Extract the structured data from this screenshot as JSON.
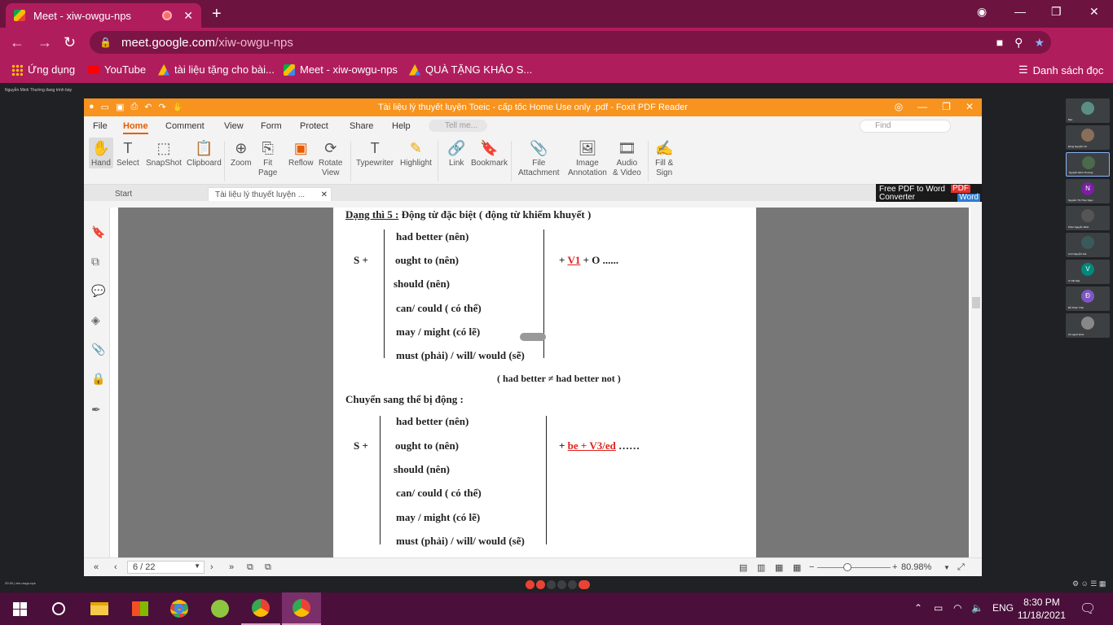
{
  "browser": {
    "tab_title": "Meet - xiw-owgu-nps",
    "url_domain": "meet.google.com",
    "url_path": "/xiw-owgu-nps",
    "bookmarks": [
      "Ứng dụng",
      "YouTube",
      "tài liệu tặng cho bài...",
      "Meet - xiw-owgu-nps",
      "QUÀ TẶNG KHẢO S..."
    ],
    "reading_list": "Danh sách đọc"
  },
  "foxit": {
    "title": "Tài liệu lý thuyết luyện Toeic - cấp tốc Home Use only .pdf - Foxit PDF Reader",
    "menu": [
      "File",
      "Home",
      "Comment",
      "View",
      "Form",
      "Protect",
      "Share",
      "Help"
    ],
    "tell_me": "Tell me...",
    "find": "Find",
    "tools": {
      "hand": "Hand",
      "select": "Select",
      "snapshot": "SnapShot",
      "clipboard": "Clipboard",
      "zoom": "Zoom",
      "fit1": "Fit",
      "fit2": "Page",
      "reflow": "Reflow",
      "rotate1": "Rotate",
      "rotate2": "View",
      "typewriter": "Typewriter",
      "highlight": "Highlight",
      "link": "Link",
      "bookmark": "Bookmark",
      "file1": "File",
      "file2": "Attachment",
      "image1": "Image",
      "image2": "Annotation",
      "audio1": "Audio",
      "audio2": "& Video",
      "fill1": "Fill &",
      "fill2": "Sign"
    },
    "doc_tabs": [
      "Start",
      "Tài liệu lý thuyết luyện ..."
    ],
    "promo": {
      "line1": "Free PDF to Word",
      "line2": "Converter",
      "pdf": "PDF",
      "word": "Word"
    },
    "status": {
      "page": "6 / 22",
      "zoom": "80.98%"
    }
  },
  "document": {
    "heading_label": "Dạng thì 5 :",
    "heading_text": " Động từ đặc biệt ( động từ khiếm khuyết )",
    "subject": "S +",
    "modals": [
      "had better (nên)",
      "ought to (nên)",
      "should (nên)",
      "can/ could ( có thể)",
      "may / might (có lẽ)",
      "must (phải) / will/ would (sẽ)"
    ],
    "active_prefix": "+ ",
    "active_red": "V1",
    "active_suffix": " + O ......",
    "note": "( had better ≠ had better not )",
    "passive_heading": "Chuyển sang thể bị động :",
    "passive_prefix": "+ ",
    "passive_red": "be + V3/ed",
    "passive_suffix": " ……"
  },
  "meet": {
    "presenter_label": "Nguyễn Minh Thường đang trình bày",
    "meeting_code": "20:30  |  xiw-owgu-nps",
    "participants": [
      {
        "name": "Bạn",
        "initial": "",
        "color": "#5a8f86"
      },
      {
        "name": "Đông Nguyễn Vũ",
        "initial": "",
        "color": "#8a6e5a"
      },
      {
        "name": "Nguyễn Minh Thường",
        "initial": "",
        "color": "#4a6a4a"
      },
      {
        "name": "Nguyễn Thị Thúy Ngọc",
        "initial": "N",
        "color": "#7b1fa2"
      },
      {
        "name": "Phúc Nguyễn Minh",
        "initial": "",
        "color": "#555"
      },
      {
        "name": "Linh Nguyễn Gia",
        "initial": "",
        "color": "#3a5a5a"
      },
      {
        "name": "Vi Văn Đại",
        "initial": "V",
        "color": "#00897b"
      },
      {
        "name": "Đỗ Thiên Thái",
        "initial": "Đ",
        "color": "#7e57c2"
      },
      {
        "name": "23 người khác",
        "initial": "",
        "color": "#888"
      }
    ]
  },
  "taskbar": {
    "lang": "ENG",
    "time": "8:30 PM",
    "date": "11/18/2021"
  }
}
